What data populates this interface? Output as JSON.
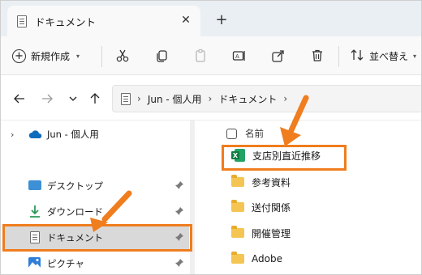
{
  "tab": {
    "title": "ドキュメント",
    "close_glyph": "✕",
    "new_glyph": "+"
  },
  "toolbar": {
    "new_label": "新規作成",
    "sort_label": "並べ替え"
  },
  "address": {
    "crumbs": [
      "Jun - 個人用",
      "ドキュメント"
    ]
  },
  "sidebar": {
    "items": [
      {
        "label": "Jun - 個人用",
        "icon": "onedrive-cloud-icon"
      },
      {
        "label": "デスクトップ",
        "icon": "desktop-icon"
      },
      {
        "label": "ダウンロード",
        "icon": "download-icon"
      },
      {
        "label": "ドキュメント",
        "icon": "document-icon"
      },
      {
        "label": "ピクチャ",
        "icon": "pictures-icon"
      }
    ]
  },
  "file_list": {
    "header": "名前",
    "items": [
      {
        "name": "支店別直近推移",
        "icon": "excel-file-icon"
      },
      {
        "name": "参考資料",
        "icon": "folder-icon"
      },
      {
        "name": "送付関係",
        "icon": "folder-icon"
      },
      {
        "name": "開催管理",
        "icon": "folder-icon"
      },
      {
        "name": "Adobe",
        "icon": "folder-icon"
      }
    ]
  },
  "colors": {
    "highlight": "#f07d1e",
    "selected_bg": "#d9d9d9",
    "tabstrip_bg": "#eaeff4"
  }
}
